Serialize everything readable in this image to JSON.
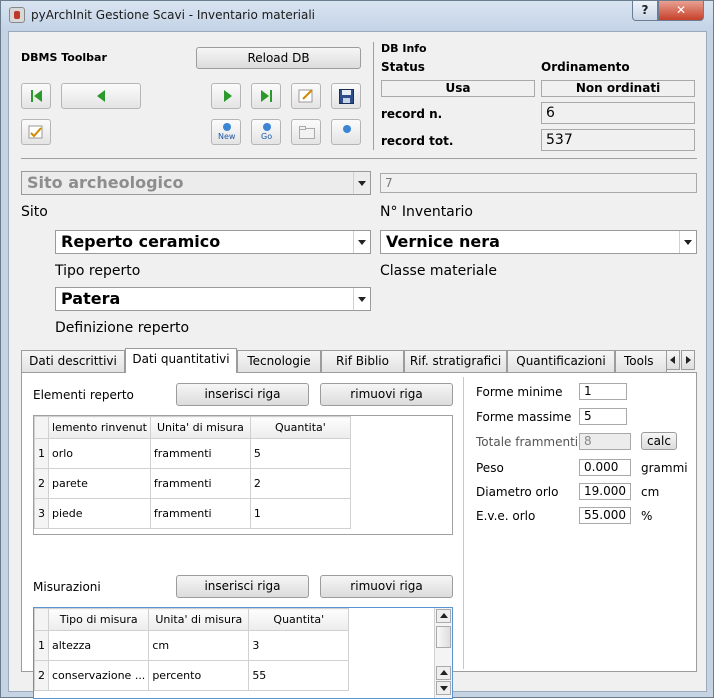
{
  "window": {
    "title": "pyArchInit Gestione Scavi - Inventario materiali",
    "help_label": "?",
    "close_label": "✕"
  },
  "toolbar": {
    "title": "DBMS Toolbar",
    "reload_label": "Reload DB",
    "new_label": "New",
    "go_label": "Go"
  },
  "dbinfo": {
    "title": "DB Info",
    "status_label": "Status",
    "order_label": "Ordinamento",
    "status_value": "Usa",
    "order_value": "Non ordinati",
    "record_n_label": "record n.",
    "record_n_value": "6",
    "record_tot_label": "record tot.",
    "record_tot_value": "537"
  },
  "form": {
    "sito_value": "Sito archeologico",
    "sito_label": "Sito",
    "inventario_value": "7",
    "inventario_label": "N° Inventario",
    "tipo_value": "Reperto ceramico",
    "tipo_label": "Tipo reperto",
    "classe_value": "Vernice nera",
    "classe_label": "Classe materiale",
    "definizione_value": "Patera",
    "definizione_label": "Definizione reperto"
  },
  "tabs": [
    "Dati descrittivi",
    "Dati quantitativi",
    "Tecnologie",
    "Rif Biblio",
    "Rif. stratigrafici",
    "Quantificazioni",
    "Tools"
  ],
  "elementi": {
    "title": "Elementi reperto",
    "insert_label": "inserisci riga",
    "remove_label": "rimuovi riga",
    "headers": [
      "lemento rinvenut",
      "Unita' di misura",
      "Quantita'"
    ],
    "rows": [
      [
        "1",
        "orlo",
        "frammenti",
        "5"
      ],
      [
        "2",
        "parete",
        "frammenti",
        "2"
      ],
      [
        "3",
        "piede",
        "frammenti",
        "1"
      ]
    ]
  },
  "misurazioni": {
    "title": "Misurazioni",
    "insert_label": "inserisci riga",
    "remove_label": "rimuovi riga",
    "headers": [
      "Tipo di misura",
      "Unita' di misura",
      "Quantita'"
    ],
    "rows": [
      [
        "1",
        "altezza",
        "cm",
        "3"
      ],
      [
        "2",
        "conservazione ...",
        "percento",
        "55"
      ]
    ]
  },
  "quant": {
    "forme_minime_label": "Forme minime",
    "forme_minime_value": "1",
    "forme_massime_label": "Forme massime",
    "forme_massime_value": "5",
    "totale_label": "Totale frammenti",
    "totale_value": "8",
    "calc_label": "calc",
    "peso_label": "Peso",
    "peso_value": "0.000",
    "peso_unit": "grammi",
    "diametro_label": "Diametro orlo",
    "diametro_value": "19.000",
    "diametro_unit": "cm",
    "eve_label": "E.v.e. orlo",
    "eve_value": "55.000",
    "eve_unit": "%"
  }
}
